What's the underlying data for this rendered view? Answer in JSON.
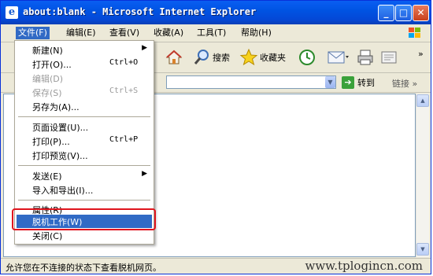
{
  "window": {
    "title": "about:blank - Microsoft Internet Explorer",
    "minimize_glyph": "_",
    "maximize_glyph": "□",
    "close_glyph": "✕"
  },
  "menubar": {
    "items": [
      {
        "label": "文件(F)",
        "active": true
      },
      {
        "label": "编辑(E)"
      },
      {
        "label": "查看(V)"
      },
      {
        "label": "收藏(A)"
      },
      {
        "label": "工具(T)"
      },
      {
        "label": "帮助(H)"
      }
    ]
  },
  "toolbar": {
    "search_label": "搜索",
    "favorites_label": "收藏夹",
    "more_glyph": "»"
  },
  "address": {
    "go_label": "转到",
    "links_label": "链接",
    "links_more": "»"
  },
  "file_menu": {
    "new": {
      "label": "新建(N)"
    },
    "open": {
      "label": "打开(O)...",
      "shortcut": "Ctrl+O"
    },
    "edit": {
      "label": "编辑(D)"
    },
    "save": {
      "label": "保存(S)",
      "shortcut": "Ctrl+S"
    },
    "save_as": {
      "label": "另存为(A)..."
    },
    "page_setup": {
      "label": "页面设置(U)..."
    },
    "print": {
      "label": "打印(P)...",
      "shortcut": "Ctrl+P"
    },
    "print_preview": {
      "label": "打印预览(V)..."
    },
    "send": {
      "label": "发送(E)"
    },
    "import_export": {
      "label": "导入和导出(I)..."
    },
    "properties": {
      "label": "属性(R)"
    },
    "work_offline": {
      "label": "脱机工作(W)"
    },
    "close": {
      "label": "关闭(C)"
    }
  },
  "statusbar": {
    "text": "允许您在不连接的状态下查看脱机网页。",
    "watermark": "www.tplogincn.com"
  },
  "colors": {
    "highlight": "#316ac5",
    "annotation_box": "#e0141d",
    "titlebar": "#0054e3"
  }
}
